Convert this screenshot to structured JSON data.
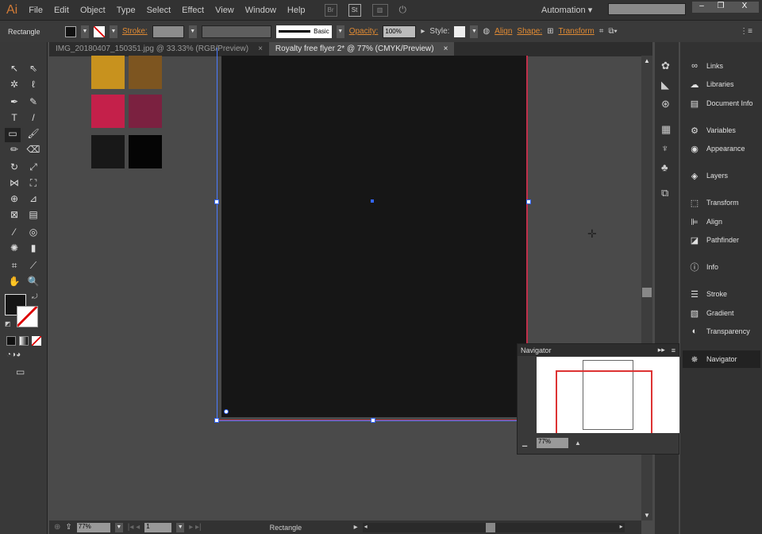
{
  "app": {
    "logo": "Ai"
  },
  "menu": [
    "File",
    "Edit",
    "Object",
    "Type",
    "Select",
    "Effect",
    "View",
    "Window",
    "Help"
  ],
  "menu_buttons": [
    "Br",
    "St"
  ],
  "workspace": "Automation",
  "search": {
    "placeholder": ""
  },
  "window_controls": [
    "–",
    "❐",
    "X"
  ],
  "control": {
    "object": "Rectangle",
    "stroke_label": "Stroke:",
    "brush": "Basic",
    "opacity_label": "Opacity:",
    "opacity": "100%",
    "style_label": "Style:",
    "align": "Align",
    "shape": "Shape:",
    "transform": "Transform"
  },
  "tabs": [
    {
      "label": "IMG_20180407_150351.jpg @ 33.33% (RGB/Preview)",
      "active": false
    },
    {
      "label": "Royalty free flyer 2* @ 77% (CMYK/Preview)",
      "active": true
    }
  ],
  "swatches": [
    "#c8921e",
    "#7d5520",
    "#c4204a",
    "#7b2140",
    "#181818",
    "#050505"
  ],
  "panels": [
    {
      "label": "Links",
      "icon": "links-icon"
    },
    {
      "label": "Libraries",
      "icon": "libraries-icon"
    },
    {
      "label": "Document Info",
      "icon": "document-info-icon"
    },
    {
      "label": "Variables",
      "icon": "variables-icon"
    },
    {
      "label": "Appearance",
      "icon": "appearance-icon"
    },
    {
      "label": "Layers",
      "icon": "layers-icon"
    },
    {
      "label": "Transform",
      "icon": "transform-icon"
    },
    {
      "label": "Align",
      "icon": "align-icon"
    },
    {
      "label": "Pathfinder",
      "icon": "pathfinder-icon"
    },
    {
      "label": "Info",
      "icon": "info-icon"
    },
    {
      "label": "Stroke",
      "icon": "stroke-icon"
    },
    {
      "label": "Gradient",
      "icon": "gradient-icon"
    },
    {
      "label": "Transparency",
      "icon": "transparency-icon"
    },
    {
      "label": "Navigator",
      "icon": "navigator-icon"
    }
  ],
  "navigator": {
    "title": "Navigator",
    "zoom": "77%"
  },
  "status": {
    "zoom": "77%",
    "artboard": "1",
    "tool": "Rectangle"
  },
  "colors": {
    "accent": "#e08a33",
    "artboard_edge": "#c0304a",
    "selection": "#3366ff"
  }
}
